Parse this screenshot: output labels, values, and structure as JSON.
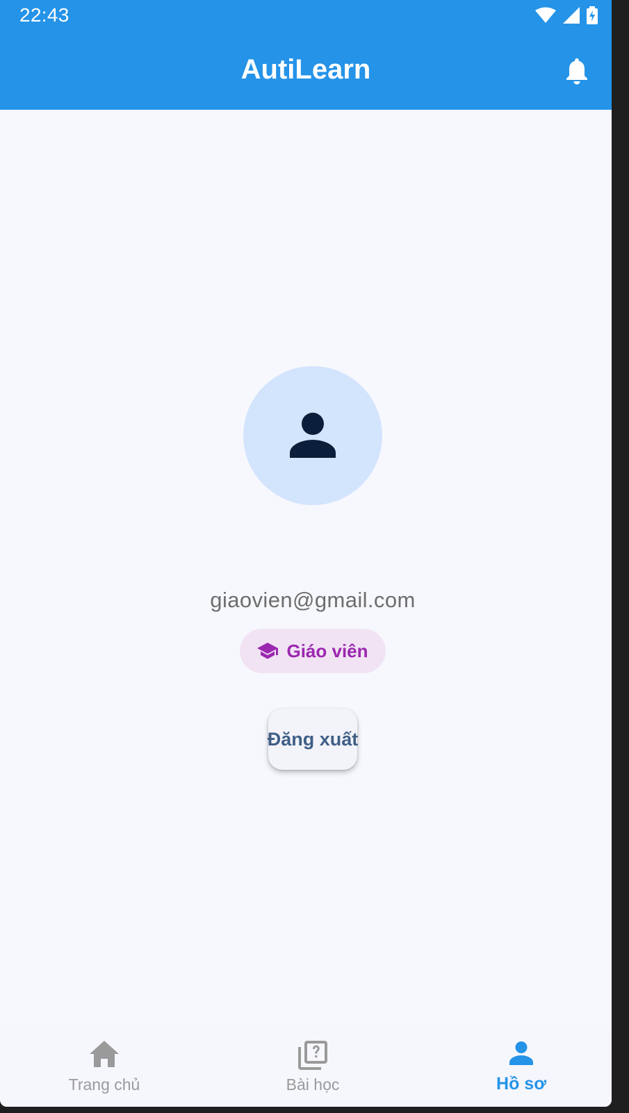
{
  "status_bar": {
    "time": "22:43",
    "icons": [
      "wifi-icon",
      "signal-icon",
      "battery-icon"
    ]
  },
  "app_bar": {
    "title": "AutiLearn",
    "action_icon": "bell-icon"
  },
  "profile": {
    "avatar_icon": "person-icon",
    "email": "giaovien@gmail.com",
    "role": {
      "icon": "graduation-cap-icon",
      "label": "Giáo viên"
    },
    "logout_label": "Đăng xuất"
  },
  "bottom_nav": {
    "items": [
      {
        "label": "Trang chủ",
        "icon": "home-icon",
        "active": false
      },
      {
        "label": "Bài học",
        "icon": "quiz-icon",
        "active": false
      },
      {
        "label": "Hồ sơ",
        "icon": "person-icon",
        "active": true
      }
    ]
  },
  "colors": {
    "primary": "#2493e8",
    "background": "#f7f8fd",
    "avatar_bg": "#d3e4fd",
    "chip_bg": "#f1e3f4",
    "chip_text": "#9c27b0",
    "button_text": "#3f5f86",
    "inactive_nav": "#9a9a9a"
  }
}
